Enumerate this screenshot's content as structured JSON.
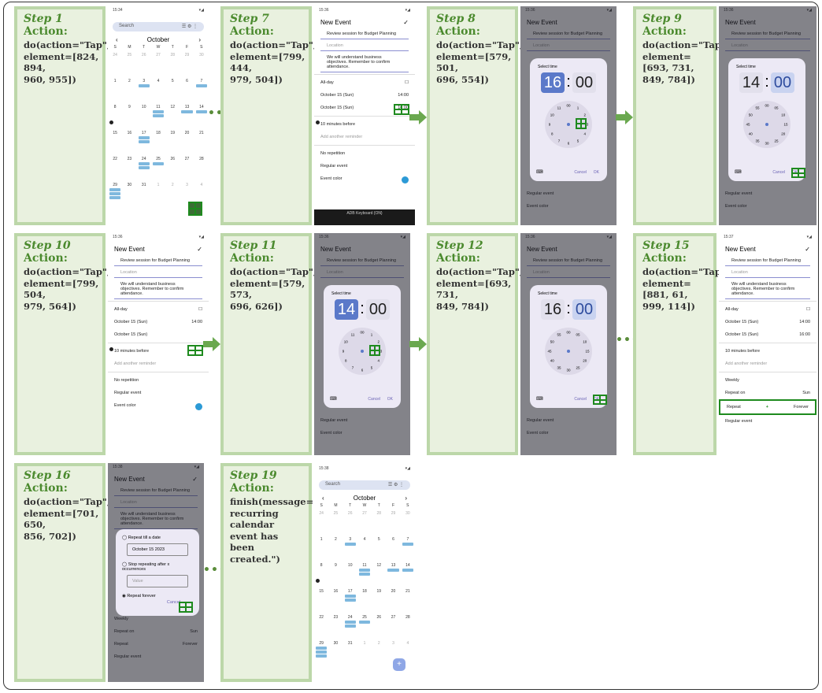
{
  "steps": [
    {
      "step": "Step 1",
      "action_header": "Action:",
      "action": "do(action=\"Tap\",\nelement=[824, 894,\n960, 955])"
    },
    {
      "step": "Step 7",
      "action_header": "Action:",
      "action": "do(action=\"Tap\",\nelement=[799, 444,\n979, 504])"
    },
    {
      "step": "Step 8",
      "action_header": "Action:",
      "action": "do(action=\"Tap\",\nelement=[579, 501,\n696, 554])"
    },
    {
      "step": "Step 9",
      "action_header": "Action:",
      "action": "do(action=\"Tap\",\nelement=[693, 731,\n849, 784])"
    },
    {
      "step": "Step 10",
      "action_header": "Action:",
      "action": "do(action=\"Tap\",\nelement=[799, 504,\n979, 564])"
    },
    {
      "step": "Step 11",
      "action_header": "Action:",
      "action": "do(action=\"Tap\",\nelement=[579, 573,\n696, 626])"
    },
    {
      "step": "Step 12",
      "action_header": "Action:",
      "action": "do(action=\"Tap\",\nelement=[693, 731,\n849, 784])"
    },
    {
      "step": "Step 15",
      "action_header": "Action:",
      "action": "do(action=\"Tap\",\nelement=[881, 61,\n999, 114])"
    },
    {
      "step": "Step 16",
      "action_header": "Action:",
      "action": "do(action=\"Tap\",\nelement=[701, 650,\n856, 702])"
    },
    {
      "step": "Step 19",
      "action_header": "Action:",
      "action": "finish(message=\"A\nrecurring calendar\nevent has been\ncreated.\")"
    }
  ],
  "calendar": {
    "search": "Search",
    "month": "October",
    "weekdays": [
      "S",
      "M",
      "T",
      "W",
      "T",
      "F",
      "S"
    ],
    "weeks": [
      [
        "24",
        "25",
        "26",
        "27",
        "28",
        "29",
        "30"
      ],
      [
        "1",
        "2",
        "3",
        "4",
        "5",
        "6",
        "7"
      ],
      [
        "8",
        "9",
        "10",
        "11",
        "12",
        "13",
        "14"
      ],
      [
        "15",
        "16",
        "17",
        "18",
        "19",
        "20",
        "21"
      ],
      [
        "22",
        "23",
        "24",
        "25",
        "26",
        "27",
        "28"
      ],
      [
        "29",
        "30",
        "31",
        "1",
        "2",
        "3",
        "4"
      ]
    ]
  },
  "event_form": {
    "header": "New Event",
    "title": "Review session for Budget Planning",
    "location_placeholder": "Location",
    "description": "We will understand business objectives. Remember to confirm attendance.",
    "all_day": "All-day",
    "start_date": "October 15 (Sun)",
    "end_date": "October 15 (Sun)",
    "start_time": "14:00",
    "end_time": "16:00",
    "reminder": "10 minutes before",
    "add_reminder": "Add another reminder",
    "repetition": "No repetition",
    "weekly": "Weekly",
    "repeat_on": "Repeat on",
    "repeat_on_value": "Sun",
    "repeat": "Repeat",
    "repeat_value": "Forever",
    "event_type": "Regular event",
    "event_color": "Event color",
    "keyboard": "ADB Keyboard {ON}"
  },
  "time_picker": {
    "title": "Select time",
    "cancel": "Cancel",
    "ok": "OK",
    "step8": {
      "hour": "16",
      "minute": "00"
    },
    "step9": {
      "hour": "14",
      "minute": "00"
    },
    "step11": {
      "hour": "14",
      "minute": "00"
    },
    "step12": {
      "hour": "16",
      "minute": "00"
    },
    "hours_outer": [
      "00",
      "1",
      "2",
      "3",
      "4",
      "5",
      "6",
      "7",
      "8",
      "9",
      "10",
      "11"
    ],
    "minutes": [
      "00",
      "05",
      "10",
      "15",
      "20",
      "25",
      "30",
      "35",
      "40",
      "45",
      "50",
      "55"
    ]
  },
  "repeat_dialog": {
    "till_date": "Repeat till a date",
    "date_value": "October 15 2023",
    "after_occ": "Stop repeating after x occurrences",
    "value_placeholder": "Value",
    "forever": "Repeat forever",
    "cancel": "Cancel"
  },
  "colors": {
    "card_bg": "#e9f1df",
    "card_border": "#bcd7a9",
    "step_green": "#4b8a2e",
    "tap_green": "#1e8a1e",
    "event_blue": "#7eb8de"
  }
}
